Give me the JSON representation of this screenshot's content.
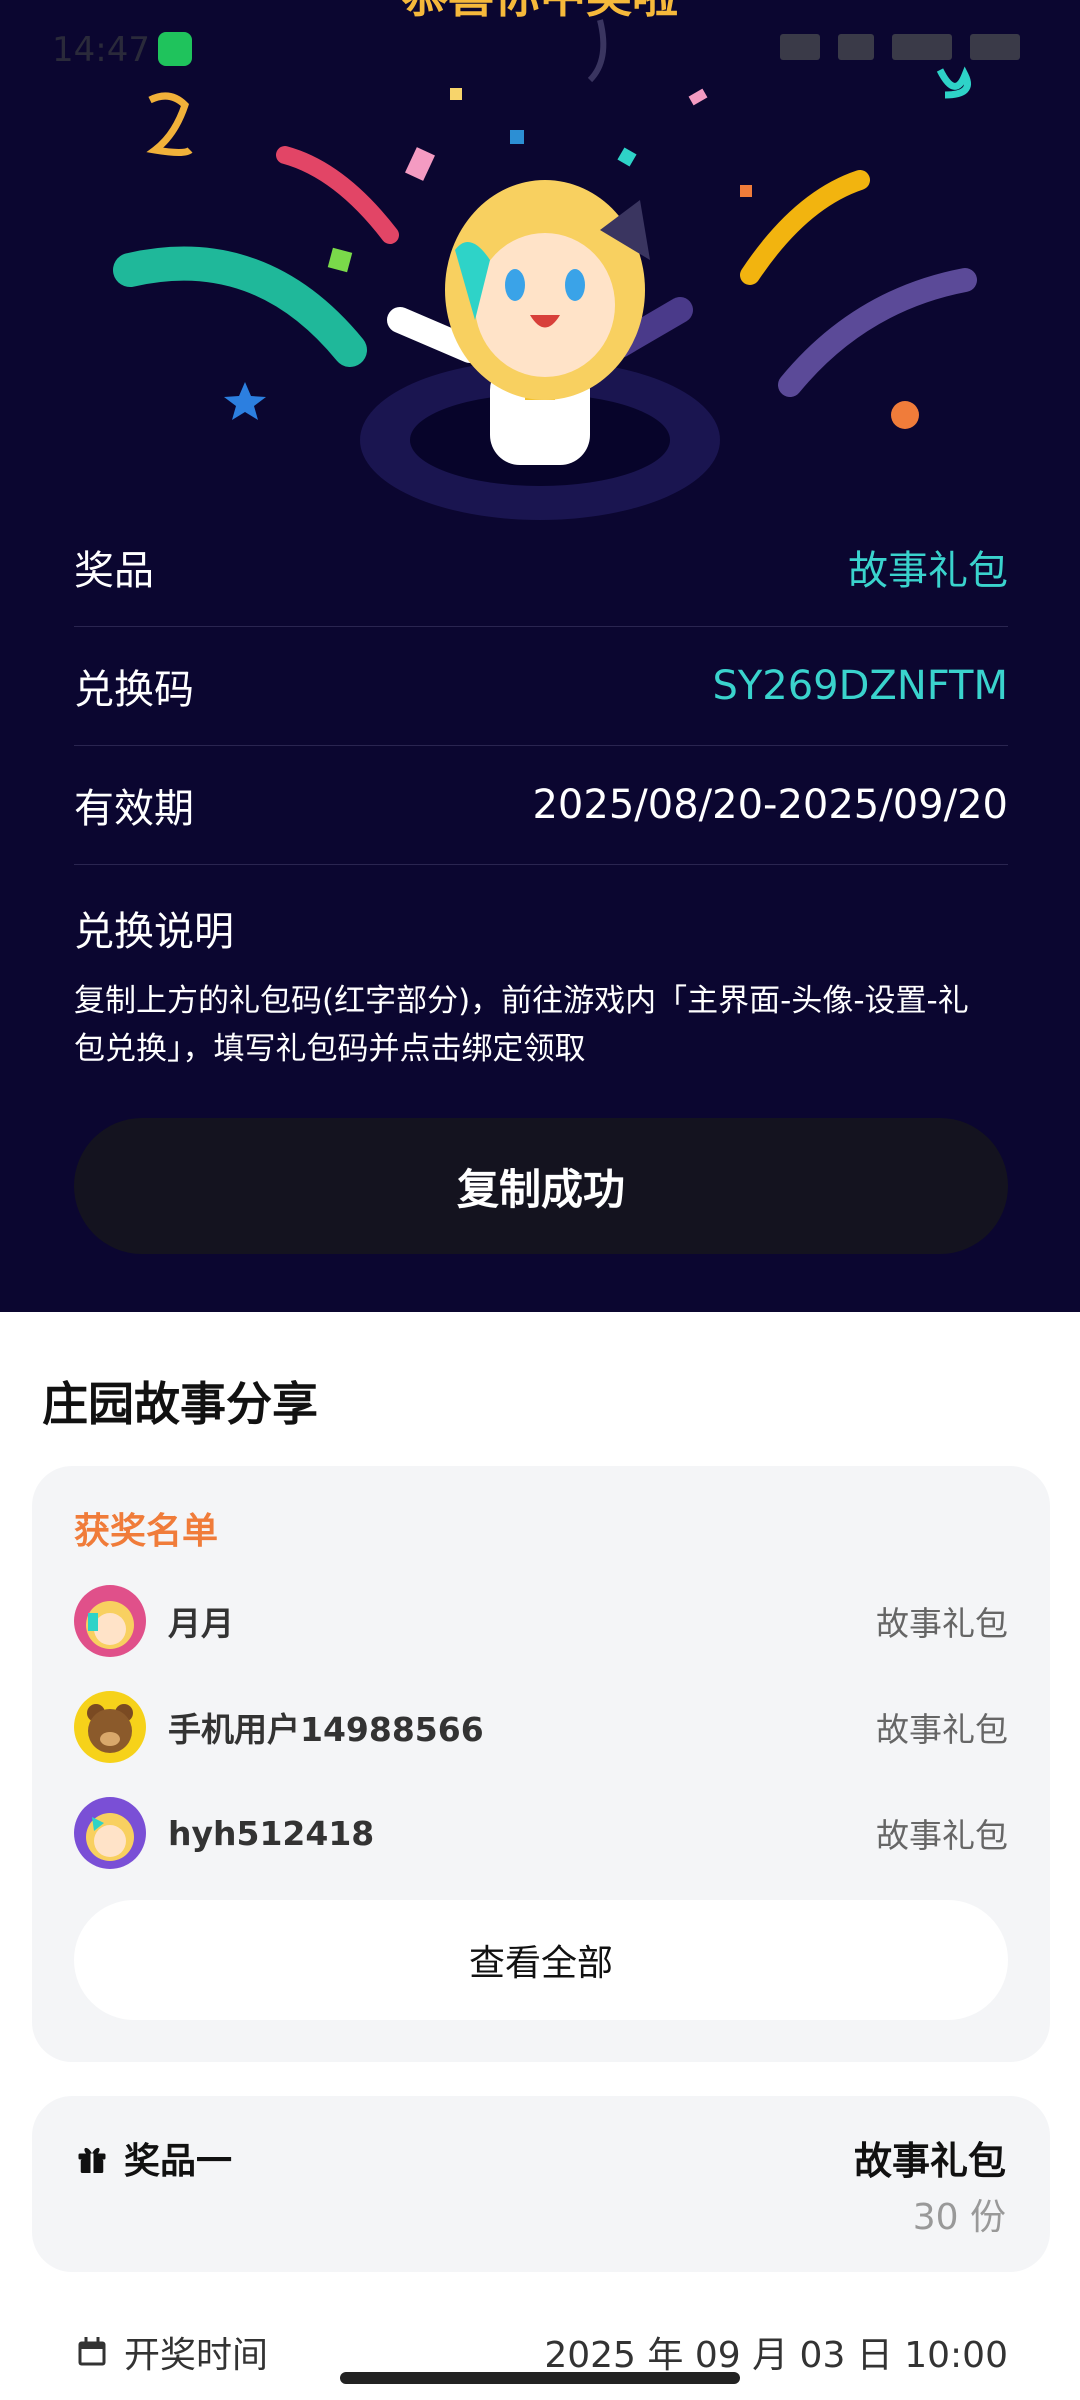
{
  "status_bar": {
    "time": "14:47"
  },
  "header": {
    "clipped_title": "恭喜你中奖啦"
  },
  "reward_info": {
    "prize_label": "奖品",
    "prize_value": "故事礼包",
    "code_label": "兑换码",
    "code_value": "SY269DZNFTM",
    "validity_label": "有效期",
    "validity_value": "2025/08/20-2025/09/20",
    "desc_title": "兑换说明",
    "desc_text": "复制上方的礼包码(红字部分)，前往游戏内「主界面-头像-设置-礼包兑换」，填写礼包码并点击绑定领取"
  },
  "copy_button": {
    "label": "复制成功"
  },
  "section": {
    "title": "庄园故事分享"
  },
  "winners": {
    "label": "获奖名单",
    "items": [
      {
        "name": "月月",
        "prize": "故事礼包"
      },
      {
        "name": "手机用户14988566",
        "prize": "故事礼包"
      },
      {
        "name": "hyh512418",
        "prize": "故事礼包"
      }
    ],
    "view_all": "查看全部"
  },
  "prize_card": {
    "label": "奖品一",
    "name": "故事礼包",
    "count": "30 份"
  },
  "draw_time": {
    "label": "开奖时间",
    "value": "2025 年 09 月 03 日 10:00"
  },
  "colors": {
    "dark_bg": "#0b0630",
    "accent_teal": "#3ad3cd",
    "winners_orange": "#f07c3a"
  }
}
